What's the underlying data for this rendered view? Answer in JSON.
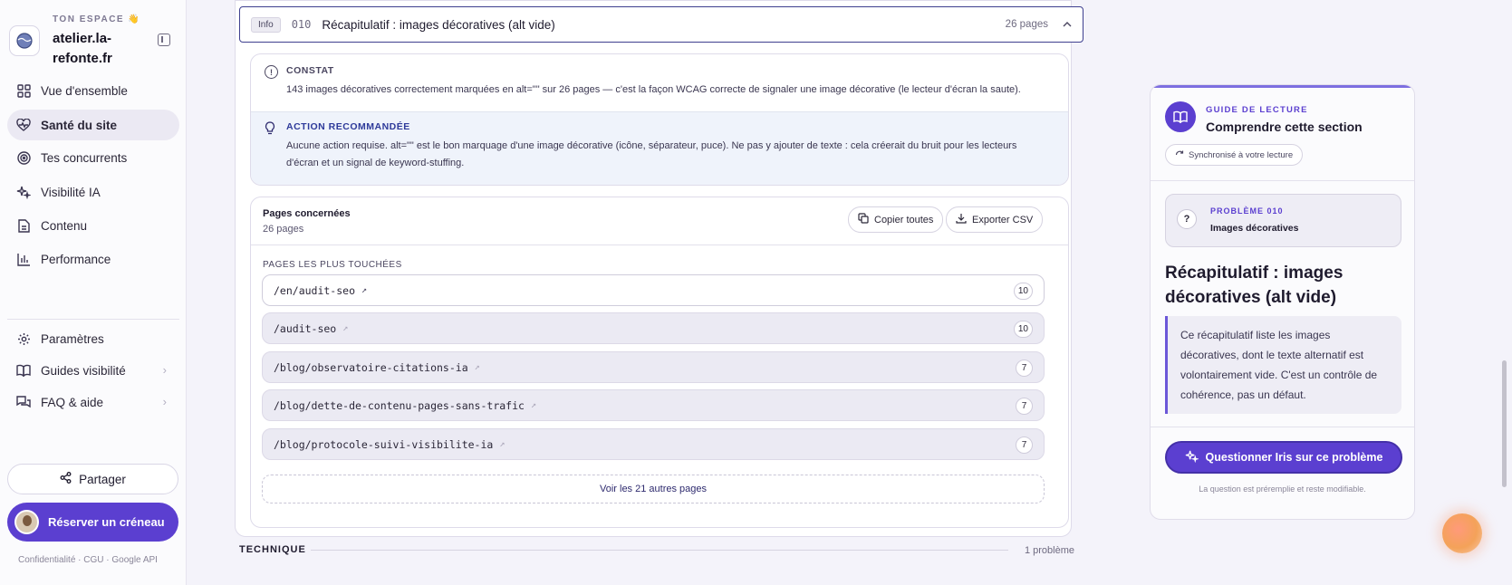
{
  "sidebar": {
    "kicker": "TON ESPACE 👋",
    "workspace": "atelier.la-refonte.fr",
    "nav": [
      {
        "label": "Vue d'ensemble",
        "icon": "grid-icon"
      },
      {
        "label": "Santé du site",
        "icon": "heart-pulse-icon"
      },
      {
        "label": "Tes concurrents",
        "icon": "target-icon"
      },
      {
        "label": "Visibilité IA",
        "icon": "sparkles-icon"
      },
      {
        "label": "Contenu",
        "icon": "document-icon"
      },
      {
        "label": "Performance",
        "icon": "bar-chart-icon"
      }
    ],
    "secondary": [
      {
        "label": "Paramètres",
        "icon": "gear-icon"
      },
      {
        "label": "Guides visibilité",
        "icon": "book-icon"
      },
      {
        "label": "FAQ & aide",
        "icon": "chat-icon"
      }
    ],
    "share": "Partager",
    "book": "Réserver un créneau",
    "footer": "Confidentialité · CGU · Google API"
  },
  "issue": {
    "badge": "Info",
    "code": "010",
    "title": "Récapitulatif : images décoratives (alt vide)",
    "count": "26 pages",
    "constat_label": "CONSTAT",
    "constat_text": "143 images décoratives correctement marquées en alt=\"\" sur 26 pages — c'est la façon WCAG correcte de signaler une image décorative (le lecteur d'écran la saute).",
    "action_label": "ACTION RECOMMANDÉE",
    "action_text_1": "Aucune action requise. alt=\"\" est le bon marquage d'une image décorative (icône, séparateur, puce). Ne pas y ajouter de texte : cela créerait du bruit pour les lecteurs",
    "action_text_2": "d'écran et un signal de keyword-stuffing."
  },
  "pages": {
    "title": "Pages concernées",
    "count": "26 pages",
    "copy": "Copier toutes",
    "export": "Exporter CSV",
    "kicker": "PAGES LES PLUS TOUCHÉES",
    "rows": [
      {
        "path": "/en/audit-seo",
        "n": "10"
      },
      {
        "path": "/audit-seo",
        "n": "10"
      },
      {
        "path": "/blog/observatoire-citations-ia",
        "n": "7"
      },
      {
        "path": "/blog/dette-de-contenu-pages-sans-trafic",
        "n": "7"
      },
      {
        "path": "/blog/protocole-suivi-visibilite-ia",
        "n": "7"
      }
    ],
    "more": "Voir les 21 autres pages"
  },
  "section": {
    "label": "TECHNIQUE",
    "count": "1 problème"
  },
  "guide": {
    "kicker": "GUIDE DE LECTURE",
    "title": "Comprendre cette section",
    "sync": "Synchronisé à votre lecture",
    "problem_kicker": "PROBLÈME 010",
    "problem_title": "Images décoratives",
    "heading": "Récapitulatif : images décoratives (alt vide)",
    "text": "Ce récapitulatif liste les images décoratives, dont le texte alternatif est volontairement vide. C'est un contrôle de cohérence, pas un défaut.",
    "ask": "Questionner Iris sur ce problème",
    "ask_note": "La question est préremplie et reste modifiable."
  },
  "colors": {
    "accent": "#5b3fd0",
    "border_focus": "#3e3f8f"
  }
}
